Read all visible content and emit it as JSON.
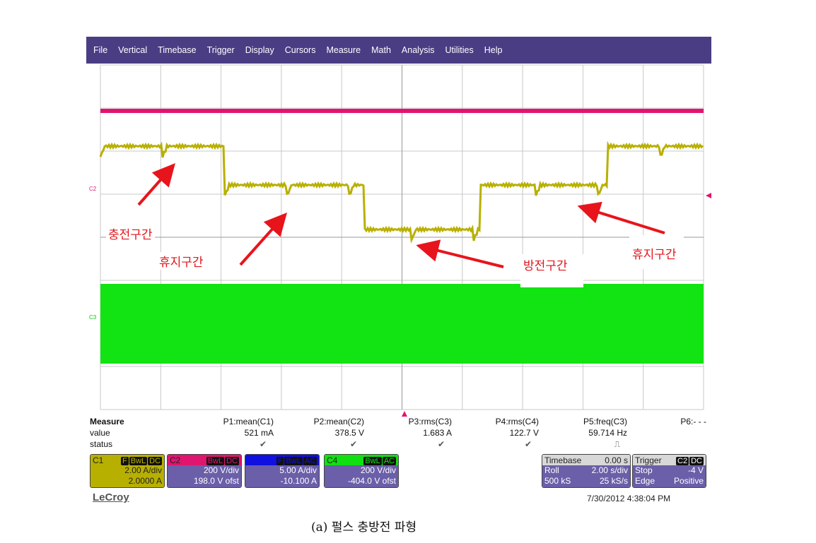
{
  "menu": [
    "File",
    "Vertical",
    "Timebase",
    "Trigger",
    "Display",
    "Cursors",
    "Measure",
    "Math",
    "Analysis",
    "Utilities",
    "Help"
  ],
  "channel_markers": {
    "c2": "C2",
    "c3": "C3"
  },
  "colors": {
    "c1": "#b8b000",
    "c2": "#e0156f",
    "c3": "#1010e0",
    "c4": "#10e010",
    "arrow": "#e8141c",
    "menu": "#4a3d84"
  },
  "annotations": [
    "충전구간",
    "휴지구간",
    "방전구간",
    "휴지구간"
  ],
  "measure": {
    "title": "Measure",
    "value_label": "value",
    "status_label": "status",
    "params": [
      {
        "name": "P1:mean(C1)",
        "value": "521 mA",
        "status": "✔"
      },
      {
        "name": "P2:mean(C2)",
        "value": "378.5 V",
        "status": "✔"
      },
      {
        "name": "P3:rms(C3)",
        "value": "1.683 A",
        "status": "✔"
      },
      {
        "name": "P4:rms(C4)",
        "value": "122.7 V",
        "status": "✔"
      },
      {
        "name": "P5:freq(C3)",
        "value": "59.714 Hz",
        "status": "⎍"
      },
      {
        "name": "P6:- - -",
        "value": "",
        "status": ""
      }
    ]
  },
  "channels": [
    {
      "label": "C1",
      "tags": [
        "F",
        "BwL",
        "DC"
      ],
      "scale": "2.00 A/div",
      "offset": "2.0000 A"
    },
    {
      "label": "C2",
      "tags": [
        "BwL",
        "DC"
      ],
      "scale": "200 V/div",
      "offset": "198.0 V ofst"
    },
    {
      "label": "C3",
      "tags": [
        "F",
        "BwL",
        "AC"
      ],
      "scale": "5.00 A/div",
      "offset": "-10.100 A"
    },
    {
      "label": "C4",
      "tags": [
        "BwL",
        "AC"
      ],
      "scale": "200 V/div",
      "offset": "-404.0 V ofst"
    }
  ],
  "timebase": {
    "title": "Timebase",
    "delay": "0.00 s",
    "mode": "Roll",
    "rate": "2.00 s/div",
    "samples": "500 kS",
    "srate": "25 kS/s"
  },
  "trigger": {
    "title": "Trigger",
    "tags": [
      "C2",
      "DC"
    ],
    "state": "Stop",
    "level": "-4 V",
    "type": "Edge",
    "slope": "Positive"
  },
  "brand": "LeCroy",
  "datetime": "7/30/2012 4:38:04 PM",
  "caption": "(a) 펄스 충방전 파형"
}
